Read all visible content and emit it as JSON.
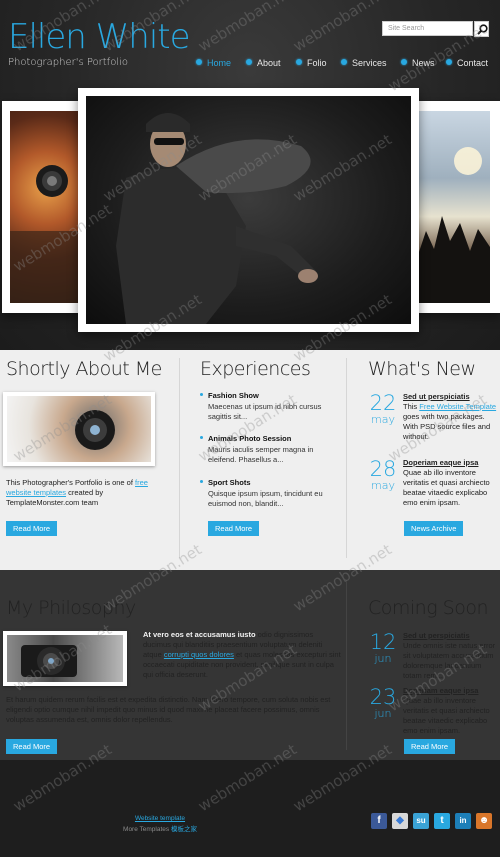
{
  "logo": {
    "name_first": "Ellen",
    "name_second": "White",
    "tagline": "Photographer's Portfolio"
  },
  "search": {
    "placeholder": "Site Search"
  },
  "nav": {
    "items": [
      "Home",
      "About",
      "Folio",
      "Services",
      "News",
      "Contact"
    ],
    "active": "Home"
  },
  "colors": {
    "accent": "#29a8e0",
    "dark_section": "#353535",
    "light_section": "#efefef",
    "footer": "#1e1e1e"
  },
  "about": {
    "title": "Shortly About Me",
    "text_before": "This Photographer's Portfolio is one of",
    "link": "free website templates",
    "text_after": "created by TemplateMonster.com team",
    "button": "Read More"
  },
  "experiences": {
    "title": "Experiences",
    "items": [
      {
        "title": "Fashion Show",
        "text": "Maecenas ut ipsum id nibh cursus sagittis sit..."
      },
      {
        "title": "Animals Photo Session",
        "text": "Mauris iaculis semper magna in eleifend. Phasellus a..."
      },
      {
        "title": "Sport Shots",
        "text": "Quisque ipsum ipsum, tincidunt eu euismod non, blandit..."
      }
    ],
    "button": "Read More"
  },
  "whats_new": {
    "title": "What's New",
    "items": [
      {
        "day": "22",
        "month": "may",
        "title": "Sed ut perspiciatis",
        "text_before": "This",
        "link": "Free Website Template",
        "text_after": "goes with two packages. With PSD source files and without."
      },
      {
        "day": "28",
        "month": "may",
        "title": "Doperiam eaque ipsa",
        "text": "Quae ab illo inventore veritatis et quasi archiecto beatae vitaedic explicabo emo enim ipsam."
      }
    ],
    "button": "News Archive"
  },
  "philosophy": {
    "title": "My Philosophy",
    "lead_bold": "At vero eos et accusamus iusto",
    "lead_1": "odio dignissimos ducimus qui blanditiis praesentium voluptatum deleniti atque",
    "lead_link": "corrupti quos dolores",
    "lead_2": "et quas molestias excepturi sint occaecati cupiditate non provident, similique sunt in culpa qui officia deserunt.",
    "paragraph": "Et harum quidem rerum facilis est et expedita distinctio. Nam libero tempore, cum soluta nobis est eligendi optio cumque nihil impedit quo minus id quod maxime placeat facere possimus, omnis voluptas assumenda est, omnis dolor repellendus.",
    "button": "Read More"
  },
  "coming_soon": {
    "title": "Coming Soon",
    "items": [
      {
        "day": "12",
        "month": "jun",
        "title": "Sed ut perspiciatis",
        "text": "Unde omnis iste natus error sit voluptatem accusantium doloremque laudantium totam rem..."
      },
      {
        "day": "23",
        "month": "jun",
        "title": "Doperiam eaque ipsa",
        "text": "Quae ab illo inventore veritatis et quasi archiecto beatae vitaedic explicabo emo enim ipsam."
      }
    ],
    "button": "Read More"
  },
  "footer": {
    "link": "Website template",
    "prefix": "More Templates",
    "suffix": "模板之家"
  },
  "social": [
    {
      "name": "facebook-icon",
      "glyph": "f",
      "color": "#3b5998"
    },
    {
      "name": "delicious-icon",
      "glyph": "◆",
      "color": "#d8d8d8"
    },
    {
      "name": "stumbleupon-icon",
      "glyph": "su",
      "color": "#3aa3d6"
    },
    {
      "name": "twitter-icon",
      "glyph": "t",
      "color": "#29a8e0"
    },
    {
      "name": "linkedin-icon",
      "glyph": "in",
      "color": "#1d7fb8"
    },
    {
      "name": "reddit-icon",
      "glyph": "☻",
      "color": "#d9762a"
    }
  ],
  "watermark": "webmoban.net"
}
